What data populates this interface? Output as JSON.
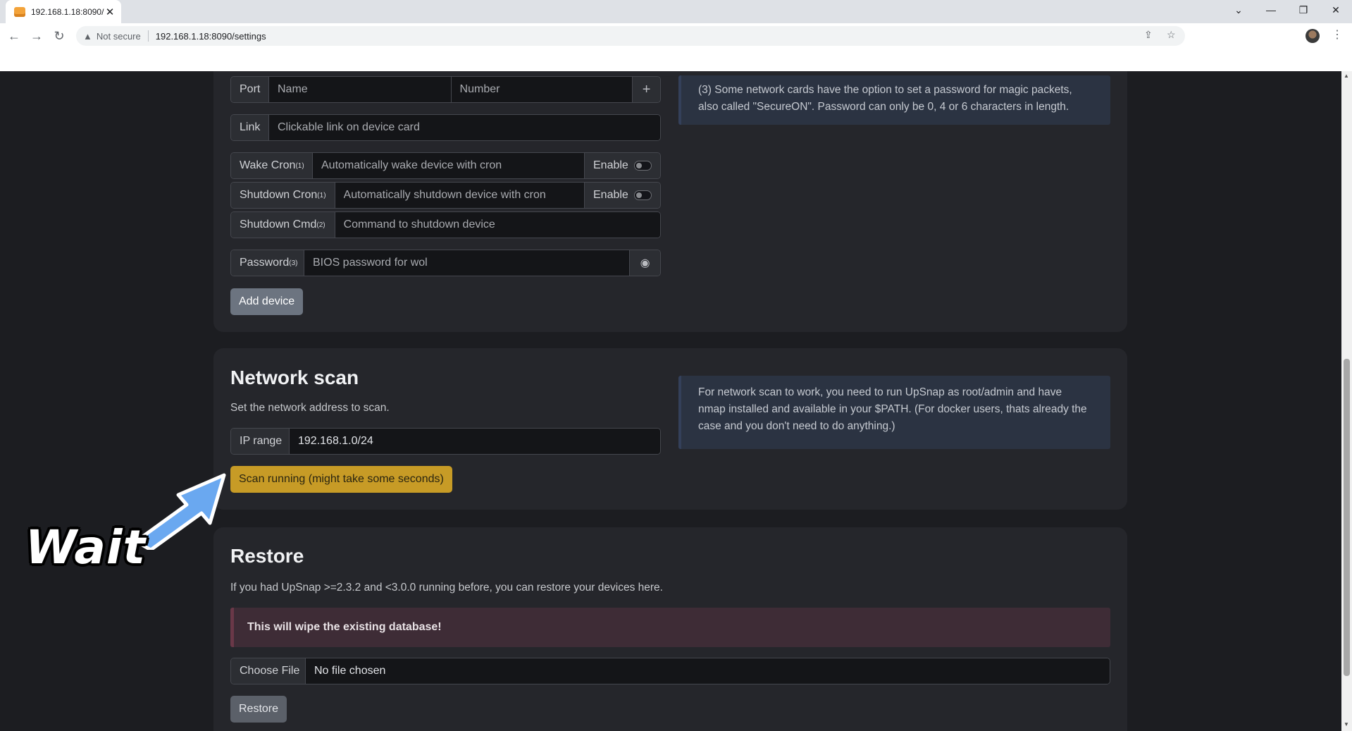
{
  "browser": {
    "tab_title": "192.168.1.18:8090/",
    "tab_close": "✕",
    "not_secure": "Not secure",
    "url": "192.168.1.18:8090/settings",
    "window_controls": {
      "minimize": "—",
      "restore": "❐",
      "close": "✕",
      "tab_search": "⌄"
    },
    "nav": {
      "back": "←",
      "forward": "→",
      "reload": "↻"
    }
  },
  "device_form": {
    "port": {
      "label": "Port",
      "name_placeholder": "Name",
      "number_placeholder": "Number",
      "add_icon": "+"
    },
    "link": {
      "label": "Link",
      "placeholder": "Clickable link on device card"
    },
    "wake_cron": {
      "label": "Wake Cron",
      "sup": "(1)",
      "placeholder": "Automatically wake device with cron",
      "toggle_label": "Enable"
    },
    "shutdown_cron": {
      "label": "Shutdown Cron",
      "sup": "(1)",
      "placeholder": "Automatically shutdown device with cron",
      "toggle_label": "Enable"
    },
    "shutdown_cmd": {
      "label": "Shutdown Cmd",
      "sup": "(2)",
      "placeholder": "Command to shutdown device"
    },
    "password": {
      "label": "Password",
      "sup": "(3)",
      "placeholder": "BIOS password for wol"
    },
    "add_button": "Add device",
    "note3_line1": "(3) Some network cards have the option to set a password for magic packets,",
    "note3_line2": "also called \"SecureON\". Password can only be 0, 4 or 6 characters in length."
  },
  "network_scan": {
    "title": "Network scan",
    "description": "Set the network address to scan.",
    "ip_label": "IP range",
    "ip_value": "192.168.1.0/24",
    "scan_button": "Scan running (might take some seconds)",
    "info_line1": "For network scan to work, you need to run UpSnap as root/admin and have",
    "info_line2": "nmap installed and available in your $PATH. (For docker users, thats already the",
    "info_line3": "case and you don't need to do anything.)"
  },
  "restore": {
    "title": "Restore",
    "description": "If you had UpSnap >=2.3.2 and <3.0.0 running before, you can restore your devices here.",
    "warning": "This will wipe the existing database!",
    "file_button": "Choose File",
    "file_status": "No file chosen",
    "restore_button": "Restore"
  },
  "annotation": {
    "text": "Wait"
  },
  "colors": {
    "scan_button": "#c79b26",
    "info_bg": "#2b3342",
    "danger_bg": "#3e2c36",
    "arrow": "#6aa8f0"
  }
}
